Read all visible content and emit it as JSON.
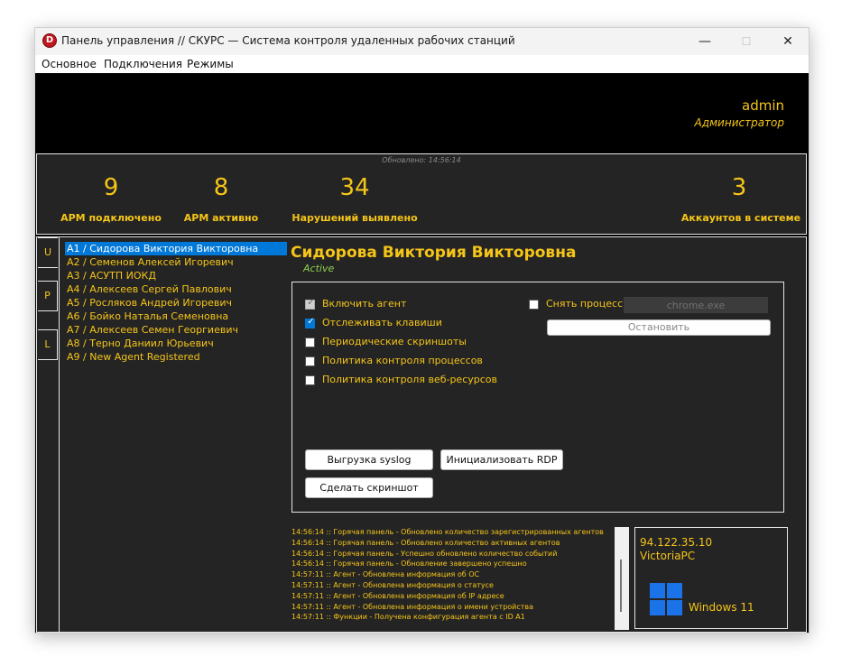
{
  "window": {
    "title": "Панель управления // СКУРС — Система контроля удаленных рабочих станций",
    "icon_letter": "D",
    "minimize": "—",
    "maximize": "☐",
    "close": "✕"
  },
  "menu": [
    "Основное",
    "Подключения",
    "Режимы"
  ],
  "header": {
    "user": "admin",
    "role": "Администратор"
  },
  "stats": {
    "updated": "Обновлено: 14:56:14",
    "items": [
      {
        "value": "9",
        "label": "АРМ подключено"
      },
      {
        "value": "8",
        "label": "АРМ активно"
      },
      {
        "value": "34",
        "label": "Нарушений выявлено"
      },
      {
        "value": "3",
        "label": "Аккаунтов в системе"
      }
    ]
  },
  "side_tabs": [
    "U",
    "P",
    "L"
  ],
  "agents": [
    "A1 / Сидорова Виктория Викторовна",
    "A2 / Семенов Алексей Игоревич",
    "A3 / АСУТП ИОКД",
    "A4 / Алексеев Сергей Павлович",
    "A5 / Росляков Андрей Игоревич",
    "A6 / Бойко Наталья Семеновна",
    "A7 / Алексеев Семен Георгиевич",
    "A8 / Терно Даниил Юрьевич",
    "A9 / New Agent Registered"
  ],
  "selected_agent": {
    "name": "Сидорова Виктория Викторовна",
    "status": "Active"
  },
  "settings": {
    "checkboxes": [
      {
        "label": "Включить агент",
        "checked": true,
        "disabled": true
      },
      {
        "label": "Отслеживать клавиши",
        "checked": true,
        "disabled": false
      },
      {
        "label": "Периодические скриншоты",
        "checked": false,
        "disabled": false
      },
      {
        "label": "Политика контроля процессов",
        "checked": false,
        "disabled": false
      },
      {
        "label": "Политика контроля веб-ресурсов",
        "checked": false,
        "disabled": false
      }
    ],
    "kill_process_label": "Снять процесс",
    "process_value": "chrome.exe",
    "stop_button": "Остановить",
    "syslog_button": "Выгрузка syslog",
    "rdp_button": "Инициализовать RDP",
    "screenshot_button": "Сделать скриншот"
  },
  "log": [
    "14:56:14 :: Горячая панель - Обновлено количество зарегистрированных агентов",
    "14:56:14 :: Горячая панель - Обновлено количество активных агентов",
    "14:56:14 :: Горячая панель - Успешно обновлено количество событий",
    "14:56:14 :: Горячая панель - Обновление завершено успешно",
    "14:57:11 :: Агент - Обновлена информация об ОС",
    "14:57:11 :: Агент - Обновлена информация о статусе",
    "14:57:11 :: Агент - Обновлена информация об IP адресе",
    "14:57:11 :: Агент - Обновлена информация о имени устройства",
    "14:57:11 :: Функции - Получена конфигурация агента с ID A1"
  ],
  "host": {
    "ip": "94.122.35.10",
    "name": "VictoriaPC",
    "os": "Windows 11"
  },
  "colors": {
    "accent": "#f5c518",
    "status_active": "#8fd14f",
    "selection": "#0078d7",
    "panel_bg": "#242424"
  }
}
